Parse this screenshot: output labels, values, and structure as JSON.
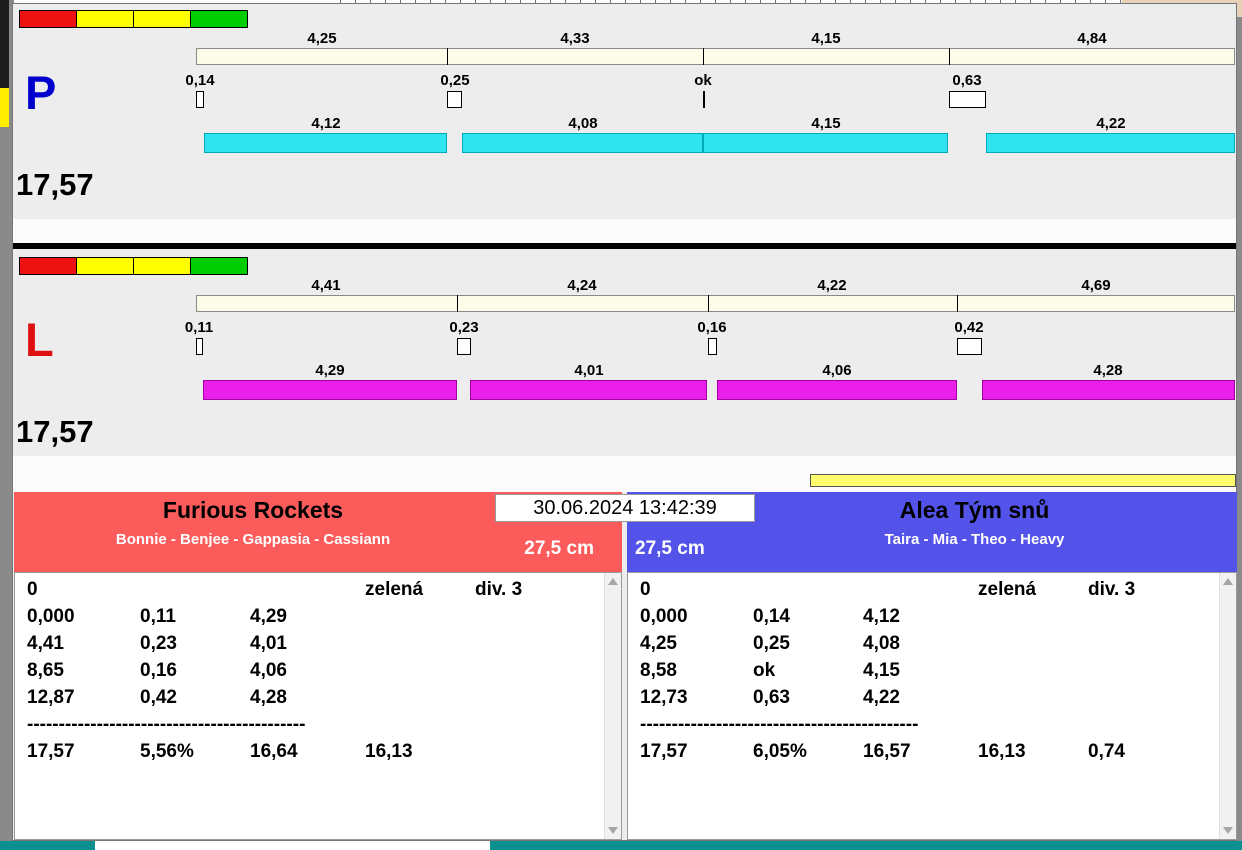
{
  "timestamp": "30.06.2024 13:42:39",
  "status_lights": [
    "#ee1111",
    "#ffff00",
    "#ffff00",
    "#00cc00"
  ],
  "lanes": [
    {
      "letter": "P",
      "letter_color": "#0000cc",
      "bar_color": "#2fe3ef",
      "bar_border": "#00aab8",
      "total_label": "17,57",
      "total": 17.57,
      "split_labels": [
        "4,25",
        "4,33",
        "4,15",
        "4,84"
      ],
      "split_cum": [
        4.25,
        8.58,
        12.73,
        17.57
      ],
      "exchange_labels": [
        "0,14",
        "0,25",
        "ok",
        "0,63"
      ],
      "exchange_values": [
        0.14,
        0.25,
        0,
        0.63
      ],
      "run_labels": [
        "4,12",
        "4,08",
        "4,15",
        "4,22"
      ],
      "run_values": [
        4.12,
        4.08,
        4.15,
        4.22
      ]
    },
    {
      "letter": "L",
      "letter_color": "#dd1111",
      "bar_color": "#ea1fea",
      "bar_border": "#a000a0",
      "total_label": "17,57",
      "total": 17.57,
      "split_labels": [
        "4,41",
        "4,24",
        "4,22",
        "4,69"
      ],
      "split_cum": [
        4.41,
        8.65,
        12.87,
        17.57
      ],
      "exchange_labels": [
        "0,11",
        "0,23",
        "0,16",
        "0,42"
      ],
      "exchange_values": [
        0.11,
        0.23,
        0.16,
        0.42
      ],
      "run_labels": [
        "4,29",
        "4,01",
        "4,06",
        "4,28"
      ],
      "run_values": [
        4.29,
        4.01,
        4.06,
        4.28
      ]
    }
  ],
  "teams": [
    {
      "name": "Furious Rockets",
      "members": "Bonnie - Benjee - Gappasia - Cassiann",
      "jump_height": "27,5 cm",
      "header_color": "#fb5b5b",
      "info_row": {
        "col1": "0",
        "col4": "zelená",
        "col5": "div. 3"
      },
      "leg_rows": [
        [
          "0,000",
          "0,11",
          "4,29"
        ],
        [
          "4,41",
          "0,23",
          "4,01"
        ],
        [
          "8,65",
          "0,16",
          "4,06"
        ],
        [
          "12,87",
          "0,42",
          "4,28"
        ]
      ],
      "divider": "--------------------------------------------",
      "total_row": [
        "17,57",
        "5,56%",
        "16,64",
        "16,13",
        ""
      ]
    },
    {
      "name": "Alea Tým snů",
      "members": "Taira - Mia - Theo - Heavy",
      "jump_height": "27,5 cm",
      "header_color": "#5353ea",
      "info_row": {
        "col1": "0",
        "col4": "zelená",
        "col5": "div. 3"
      },
      "leg_rows": [
        [
          "0,000",
          "0,14",
          "4,12"
        ],
        [
          "4,25",
          "0,25",
          "4,08"
        ],
        [
          "8,58",
          "ok",
          "4,15"
        ],
        [
          "12,73",
          "0,63",
          "4,22"
        ]
      ],
      "divider": "--------------------------------------------",
      "total_row": [
        "17,57",
        "6,05%",
        "16,57",
        "16,13",
        "0,74"
      ]
    }
  ]
}
